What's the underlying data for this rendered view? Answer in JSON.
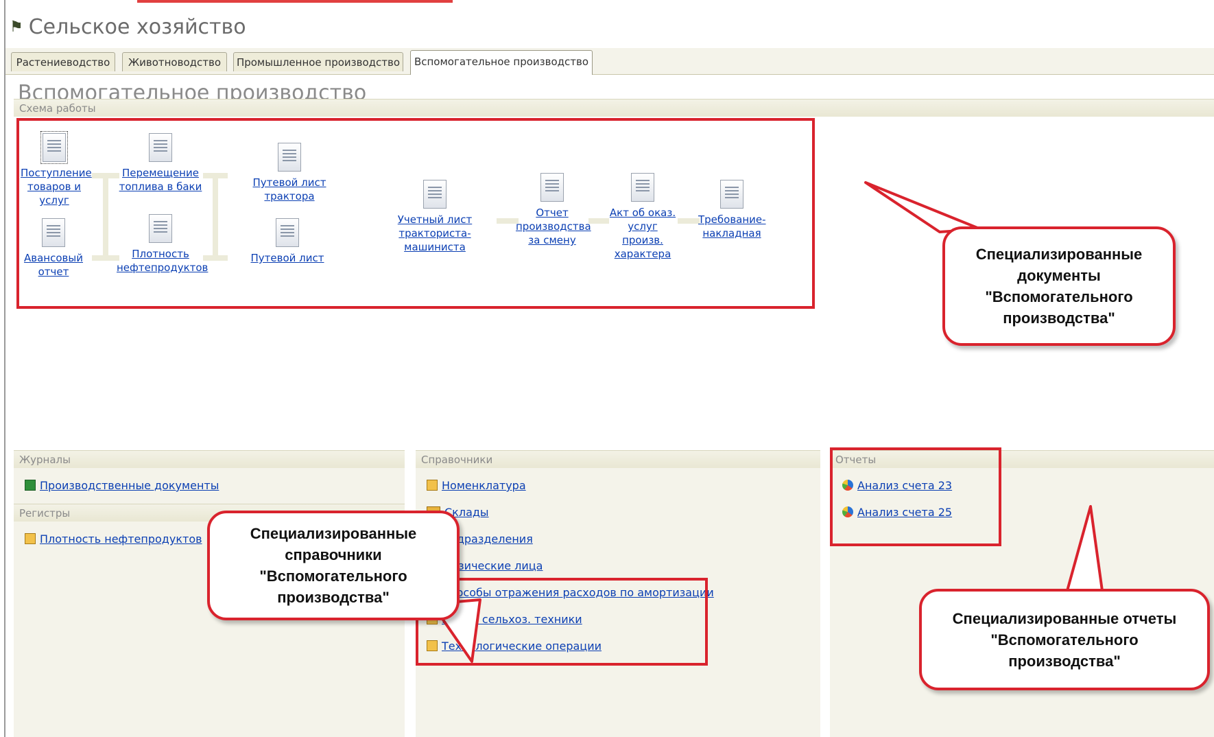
{
  "app": {
    "title": "Сельское хозяйство",
    "icon": "tractor-icon"
  },
  "tabs": [
    {
      "label": "Растениеводство",
      "active": false
    },
    {
      "label": "Животноводство",
      "active": false
    },
    {
      "label": "Промышленное производство",
      "active": false
    },
    {
      "label": "Вспомогательное производство",
      "active": true
    }
  ],
  "page": {
    "heading": "Вспомогательное производство"
  },
  "scheme": {
    "section_title": "Схема работы",
    "docs": {
      "receipt": "Поступление товаров и услуг",
      "fuel_move": "Перемещение топлива в баки",
      "tractor_waybill": "Путевой лист трактора",
      "tractor_log": "Учетный лист тракториста-машиниста",
      "shift_report": "Отчет производства за смену",
      "service_act": "Акт об оказ. услуг произв. характера",
      "requisition": "Требование-накладная",
      "advance_report": "Авансовый отчет",
      "density": "Плотность нефтепродуктов",
      "waybill": "Путевой лист"
    }
  },
  "journals": {
    "section_title": "Журналы",
    "items": [
      "Производственные документы"
    ]
  },
  "registers": {
    "section_title": "Регистры",
    "items": [
      "Плотность нефтепродуктов"
    ]
  },
  "catalogs": {
    "section_title": "Справочники",
    "items": [
      "Номенклатура",
      "Склады",
      "Подразделения",
      "Физические лица",
      "Способы отражения расходов по амортизации",
      "Марки сельхоз. техники",
      "Технологические операции"
    ]
  },
  "reports": {
    "section_title": "Отчеты",
    "items": [
      "Анализ счета 23",
      "Анализ счета 25"
    ]
  },
  "callouts": {
    "documents": "Специализированные документы \"Вспомогательного производства\"",
    "catalogs": "Специализированные справочники \"Вспомогательного производства\"",
    "reports": "Специализированные отчеты \"Вспомогательного производства\""
  },
  "colors": {
    "link": "#0b3fb3",
    "highlight": "#d9232d",
    "panel": "#f4f3ea"
  }
}
